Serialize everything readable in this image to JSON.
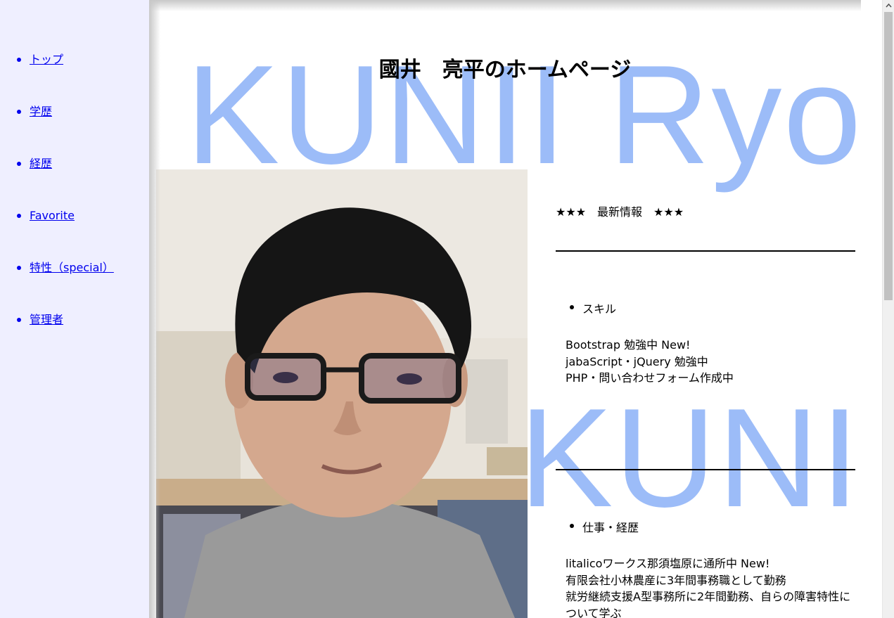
{
  "sidebar": {
    "items": [
      {
        "label": "トップ"
      },
      {
        "label": "学歴"
      },
      {
        "label": "経歴"
      },
      {
        "label": "Favorite"
      },
      {
        "label": "特性（special）"
      },
      {
        "label": "管理者"
      }
    ]
  },
  "main": {
    "title": "國井　亮平のホームページ",
    "watermark": "KUNII Ryohei",
    "news_header": "★★★　最新情報　★★★",
    "sections": [
      {
        "title": "スキル",
        "lines": [
          "Bootstrap 勉強中 New!",
          "jabaScript・jQuery 勉強中",
          "PHP・問い合わせフォーム作成中"
        ]
      },
      {
        "title": "仕事・経歴",
        "lines": [
          "litalicoワークス那須塩原に通所中 New!",
          "有限会社小林農産に3年間事務職として勤務",
          "就労継続支援A型事務所に2年間勤務、自らの障害特性に",
          "ついて学ぶ"
        ]
      }
    ]
  },
  "colors": {
    "sidebar_bg": "#efefff",
    "link": "#0000ee",
    "watermark": "#9cbcf8"
  }
}
